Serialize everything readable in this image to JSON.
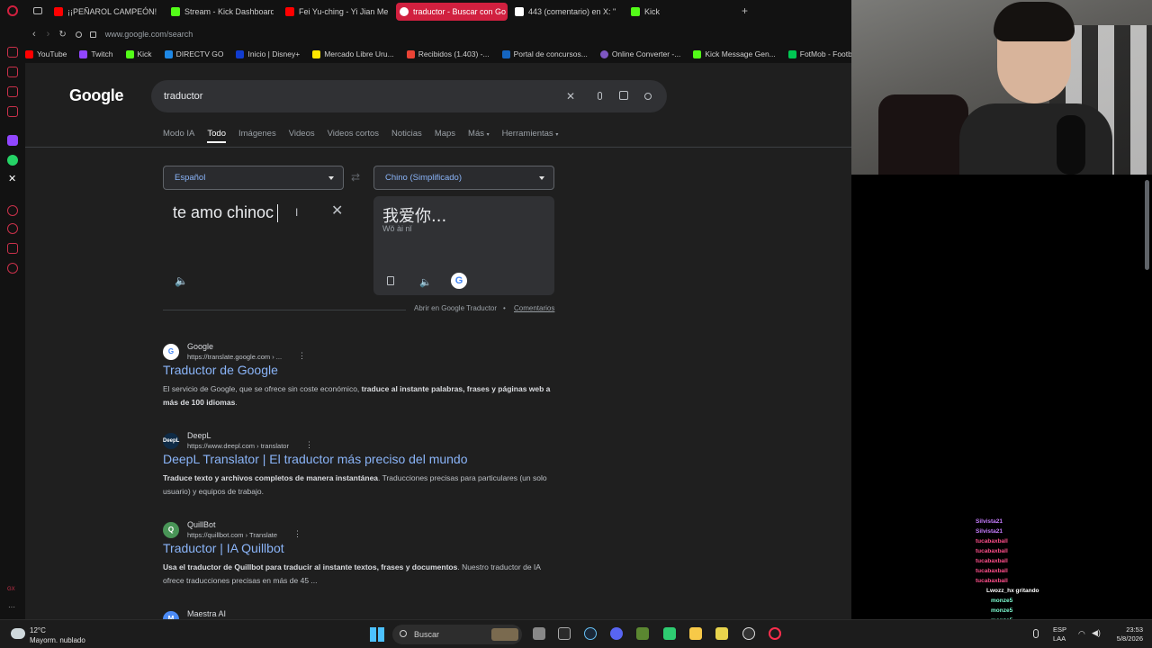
{
  "tabs": [
    {
      "label": "¡¡PEÑAROL CAMPEÓN! GO",
      "color": "#ff0000"
    },
    {
      "label": "Stream - Kick Dashboard",
      "color": "#53fc18"
    },
    {
      "label": "Fei Yu-ching - Yi Jian Mei",
      "color": "#ff0000"
    },
    {
      "label": "traductor - Buscar con Go",
      "color": "#4285f4",
      "active": true
    },
    {
      "label": "443 (comentario) en X: \"",
      "color": "#ffffff"
    },
    {
      "label": "Kick",
      "color": "#53fc18"
    }
  ],
  "address": {
    "url": "www.google.com/search"
  },
  "bookmarks": [
    {
      "label": "YouTube",
      "color": "#ff0000"
    },
    {
      "label": "Twitch",
      "color": "#9146ff"
    },
    {
      "label": "Kick",
      "color": "#53fc18"
    },
    {
      "label": "DIRECTV GO",
      "color": "#1e88e5"
    },
    {
      "label": "Inicio | Disney+",
      "color": "#113ccf"
    },
    {
      "label": "Mercado Libre Uru...",
      "color": "#ffe600"
    },
    {
      "label": "Recibidos (1.403) -...",
      "color": "#ea4335"
    },
    {
      "label": "Portal de concursos...",
      "color": "#1565c0"
    },
    {
      "label": "Online Converter -...",
      "color": "#7e57c2"
    },
    {
      "label": "Kick Message Gen...",
      "color": "#53fc18"
    },
    {
      "label": "FotMob - Football...",
      "color": "#00c853"
    }
  ],
  "google": {
    "logo": "Google",
    "query": "traductor",
    "tabs": [
      "Modo IA",
      "Todo",
      "Imágenes",
      "Videos",
      "Videos cortos",
      "Noticias",
      "Maps",
      "Más",
      "Herramientas"
    ]
  },
  "translator": {
    "source_lang": "Español",
    "target_lang": "Chino (Simplificado)",
    "source_text": "te amo chinoc",
    "output_text": "我爱你...",
    "pinyin": "Wǒ ài nǐ",
    "open_link": "Abrir en Google Traductor",
    "separator": "•",
    "feedback": "Comentarios"
  },
  "results": [
    {
      "site": "Google",
      "url": "https://translate.google.com › ...",
      "title": "Traductor de Google",
      "snippet_plain": "El servicio de Google, que se ofrece sin coste económico, ",
      "snippet_bold": "traduce al instante palabras, frases y páginas web a más de 100 idiomas",
      "snippet_tail": "."
    },
    {
      "site": "DeepL",
      "url": "https://www.deepl.com › translator",
      "title": "DeepL Translator | El traductor más preciso del mundo",
      "snippet_bold": "Traduce texto y archivos completos de manera instantánea",
      "snippet_tail": ". Traducciones precisas para particulares (un solo usuario) y equipos de trabajo."
    },
    {
      "site": "QuillBot",
      "url": "https://quillbot.com › Translate",
      "title": "Traductor | IA Quillbot",
      "snippet_bold": "Usa el traductor de Quillbot para traducir al instante textos, frases y documentos",
      "snippet_tail": ". Nuestro traductor de IA ofrece traducciones precisas en más de 45 ..."
    },
    {
      "site": "Maestra AI"
    }
  ],
  "chat": [
    {
      "user": "Silvista21",
      "color": "#c77dff"
    },
    {
      "user": "Silvista21",
      "color": "#c77dff"
    },
    {
      "user": "tucabaxball",
      "color": "#ff4f8b"
    },
    {
      "user": "tucabaxball",
      "color": "#ff4f8b"
    },
    {
      "user": "tucabaxball",
      "color": "#ff4f8b"
    },
    {
      "user": "tucabaxball",
      "color": "#ff4f8b"
    },
    {
      "user": "tucabaxball",
      "color": "#ff4f8b"
    },
    {
      "user": "Lwozz_hx",
      "color": "#ffffff",
      "msg": "gritando"
    },
    {
      "user": "monze5",
      "color": "#7fffd4"
    },
    {
      "user": "monze5",
      "color": "#7fffd4"
    },
    {
      "user": "monze5",
      "color": "#7fffd4"
    },
    {
      "user": "monze5",
      "color": "#7fffd4"
    },
    {
      "user": "monze5",
      "color": "#7fffd4"
    }
  ],
  "taskbar": {
    "weather_temp": "12°C",
    "weather_desc": "Mayorm. nublado",
    "search_label": "Buscar",
    "lang": "ESP",
    "layout": "LAA",
    "time": "23:53",
    "date": "5/8/2026"
  }
}
